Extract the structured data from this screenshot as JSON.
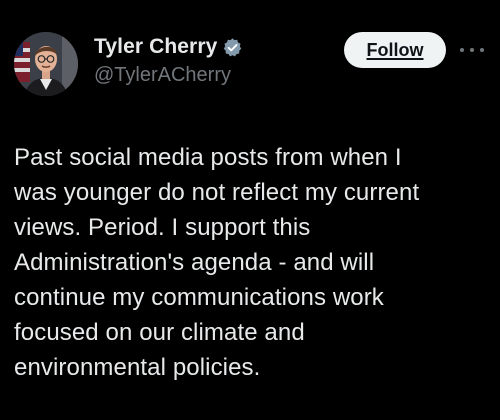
{
  "author": {
    "display_name": "Tyler Cherry",
    "handle": "@TylerACherry",
    "verified_icon": "verified-badge-icon",
    "avatar": "profile-photo"
  },
  "actions": {
    "follow_label": "Follow",
    "more_icon": "more-options-icon"
  },
  "post": {
    "text": "Past social media posts from when I\nwas younger do not reflect my current\nviews. Period. I support this\nAdministration's agenda - and will\ncontinue my communications work\nfocused on our climate and\nenvironmental policies."
  },
  "colors": {
    "background": "#000000",
    "text_primary": "#e7e9ea",
    "text_secondary": "#71767b",
    "follow_bg": "#eff3f4",
    "follow_text": "#0f1419",
    "verified_fill": "#829aab"
  }
}
